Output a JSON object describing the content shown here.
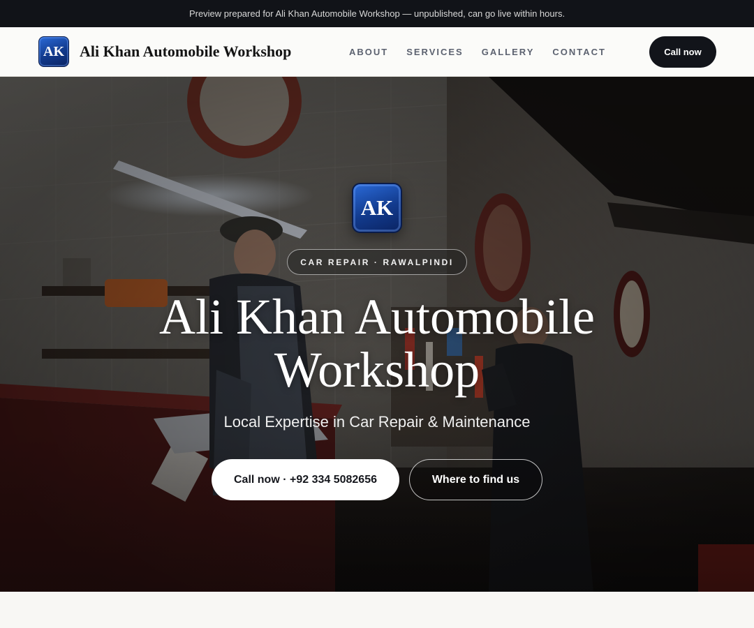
{
  "preview_bar": {
    "text": "Preview prepared for Ali Khan Automobile Workshop — unpublished, can go live within hours."
  },
  "header": {
    "logo_text": "AK",
    "brand_name": "Ali Khan Automobile Workshop",
    "nav": [
      {
        "label": "ABOUT"
      },
      {
        "label": "SERVICES"
      },
      {
        "label": "GALLERY"
      },
      {
        "label": "CONTACT"
      }
    ],
    "cta_label": "Call now"
  },
  "hero": {
    "logo_text": "AK",
    "tag": "CAR REPAIR · RAWALPINDI",
    "title": "Ali Khan Automobile Workshop",
    "subtitle": "Local Expertise in Car Repair & Maintenance",
    "primary_button": "Call now · +92 334 5082656",
    "secondary_button": "Where to find us",
    "background_image": "mechanics-in-workshop-photo"
  },
  "colors": {
    "dark": "#12141a",
    "logo_blue": "#123a8c",
    "page_bg": "#f8f7f4"
  }
}
